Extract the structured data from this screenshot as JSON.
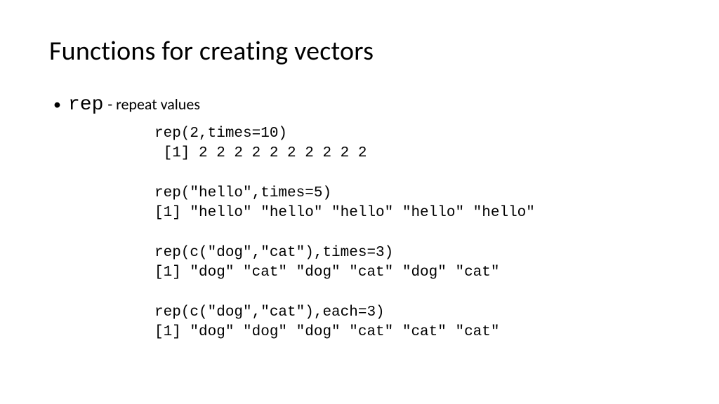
{
  "title": "Functions for creating vectors",
  "bullet": {
    "func": "rep",
    "desc": "- repeat values"
  },
  "code": "rep(2,times=10)\n [1] 2 2 2 2 2 2 2 2 2 2\n\nrep(\"hello\",times=5)\n[1] \"hello\" \"hello\" \"hello\" \"hello\" \"hello\"\n\nrep(c(\"dog\",\"cat\"),times=3)\n[1] \"dog\" \"cat\" \"dog\" \"cat\" \"dog\" \"cat\"\n\nrep(c(\"dog\",\"cat\"),each=3)\n[1] \"dog\" \"dog\" \"dog\" \"cat\" \"cat\" \"cat\""
}
